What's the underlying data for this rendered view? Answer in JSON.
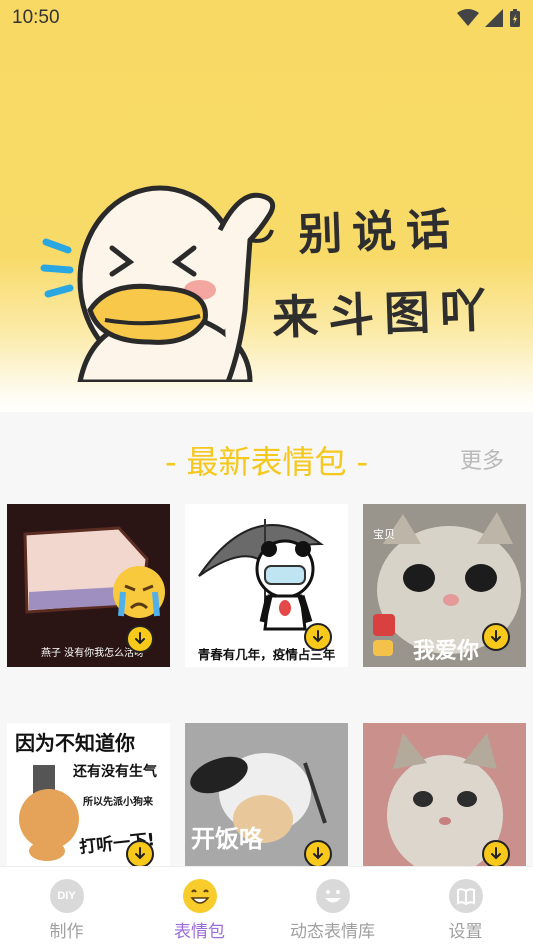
{
  "status_bar": {
    "time": "10:50"
  },
  "banner": {
    "line1": "别说话",
    "line2": "来斗图吖"
  },
  "section": {
    "title": "最新表情包",
    "more": "更多"
  },
  "tiles": [
    {
      "caption": "燕子 没有你我怎么活呀"
    },
    {
      "caption": "青春有几年，疫情占三年"
    },
    {
      "corner_text": "宝贝",
      "caption": "我爱你"
    },
    {
      "lines": [
        "因为不知道你",
        "还有没有生气",
        "所以先派小狗来",
        "打听一下!"
      ]
    },
    {
      "caption": "开饭咯"
    },
    {
      "caption": ""
    }
  ],
  "tabs": [
    {
      "label": "制作",
      "icon": "diy-icon",
      "active": false
    },
    {
      "label": "表情包",
      "icon": "smile-emoji-icon",
      "active": true
    },
    {
      "label": "动态表情库",
      "icon": "smiley-face-icon",
      "active": false
    },
    {
      "label": "设置",
      "icon": "book-icon",
      "active": false
    }
  ],
  "colors": {
    "accent_yellow": "#f6c71d",
    "tab_active": "#9c6cd9",
    "hero_bg": "#f8d964"
  }
}
